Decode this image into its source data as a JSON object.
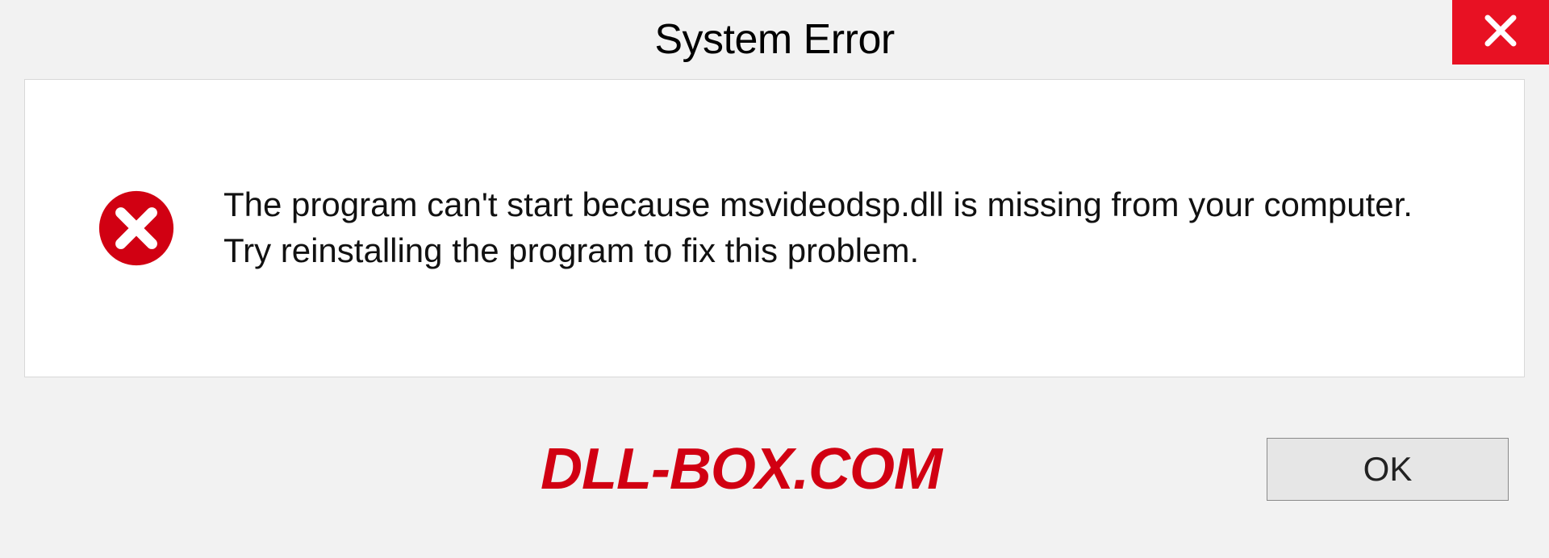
{
  "dialog": {
    "title": "System Error",
    "message": "The program can't start because msvideodsp.dll is missing from your computer. Try reinstalling the program to fix this problem.",
    "ok_label": "OK"
  },
  "watermark": {
    "text": "DLL-BOX.COM"
  },
  "colors": {
    "close_bg": "#e81123",
    "error_icon": "#d10012",
    "watermark": "#d10012"
  }
}
